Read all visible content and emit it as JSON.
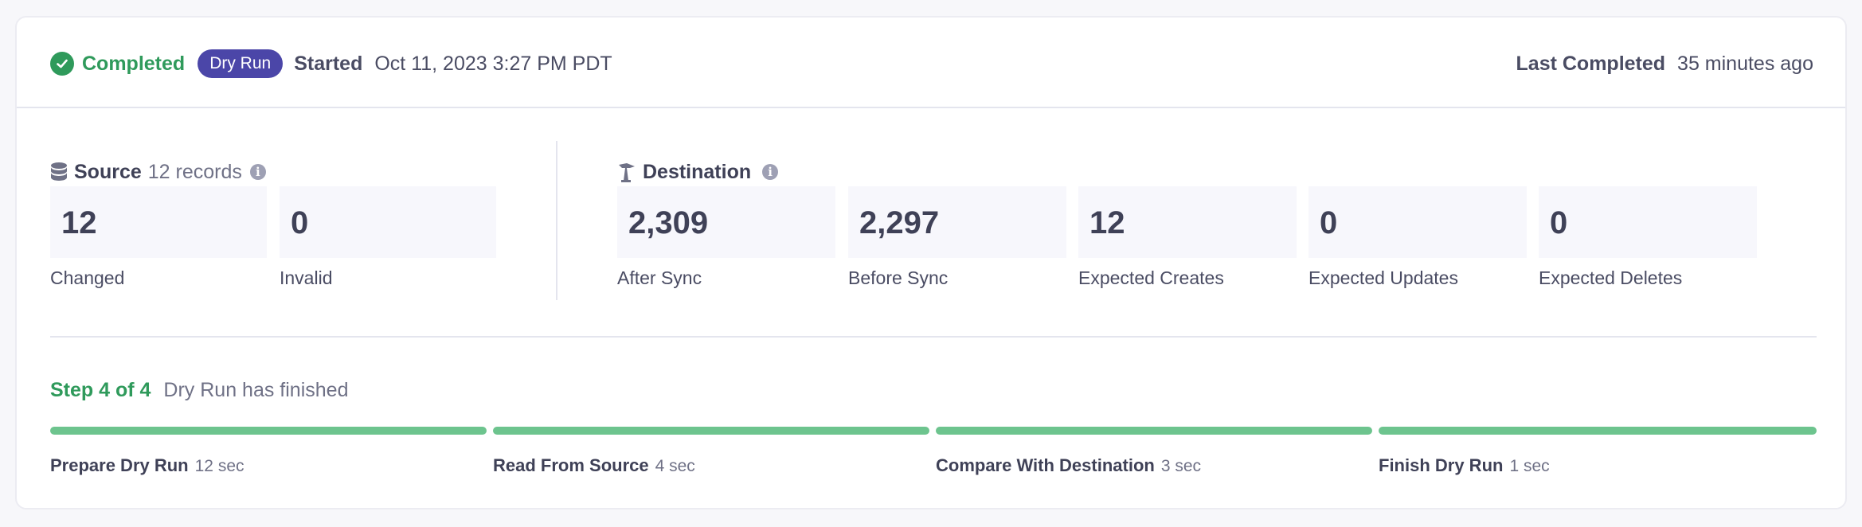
{
  "header": {
    "status": "Completed",
    "badge": "Dry Run",
    "started_label": "Started",
    "started_value": "Oct 11, 2023 3:27 PM PDT",
    "last_completed_label": "Last Completed",
    "last_completed_value": "35 minutes ago"
  },
  "source": {
    "title": "Source",
    "records": "12 records",
    "icon": "database-icon",
    "stats": [
      {
        "value": "12",
        "label": "Changed"
      },
      {
        "value": "0",
        "label": "Invalid"
      }
    ]
  },
  "destination": {
    "title": "Destination",
    "icon": "destination-icon",
    "stats": [
      {
        "value": "2,309",
        "label": "After Sync"
      },
      {
        "value": "2,297",
        "label": "Before Sync"
      },
      {
        "value": "12",
        "label": "Expected Creates"
      },
      {
        "value": "0",
        "label": "Expected Updates"
      },
      {
        "value": "0",
        "label": "Expected Deletes"
      }
    ]
  },
  "progress": {
    "step": "Step 4 of 4",
    "description": "Dry Run has finished",
    "phases": [
      {
        "name": "Prepare Dry Run",
        "time": "12 sec",
        "fraction": 1.0
      },
      {
        "name": "Read From Source",
        "time": "4 sec",
        "fraction": 1.0
      },
      {
        "name": "Compare With Destination",
        "time": "3 sec",
        "fraction": 1.0
      },
      {
        "name": "Finish Dry Run",
        "time": "1 sec",
        "fraction": 1.0
      }
    ]
  },
  "colors": {
    "success": "#2f9a5b",
    "badge": "#4b46a8",
    "progress": "#6dc48e"
  }
}
